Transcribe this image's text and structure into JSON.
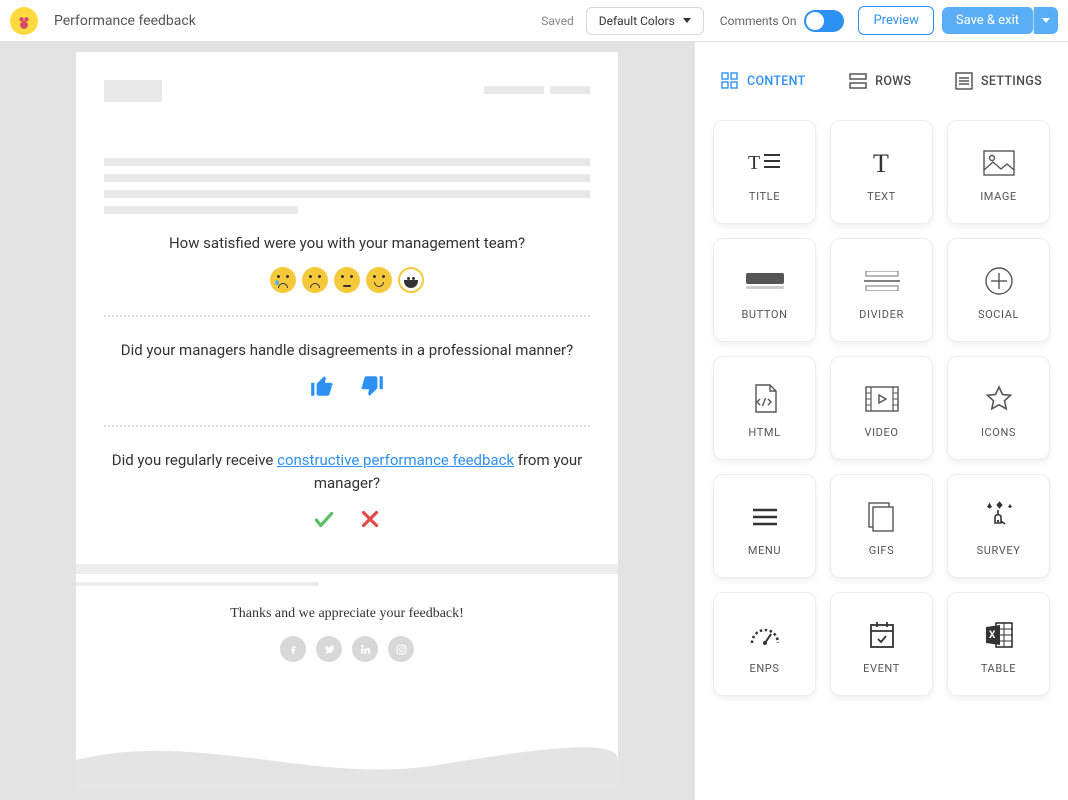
{
  "header": {
    "title": "Performance feedback",
    "saved_label": "Saved",
    "color_dropdown": "Default Colors",
    "comments_label": "Comments On",
    "preview_button": "Preview",
    "save_button": "Save & exit"
  },
  "preview": {
    "q1": "How satisfied were you with your management team?",
    "q2": "Did your managers handle disagreements in a professional manner?",
    "q3_prefix": "Did you regularly receive ",
    "q3_link": "constructive performance feedback",
    "q3_suffix": " from your manager?",
    "thanks": "Thanks and we appreciate your feedback!"
  },
  "panel": {
    "tabs": {
      "content": "CONTENT",
      "rows": "ROWS",
      "settings": "SETTINGS"
    },
    "tiles": [
      {
        "key": "title",
        "label": "TITLE"
      },
      {
        "key": "text",
        "label": "TEXT"
      },
      {
        "key": "image",
        "label": "IMAGE"
      },
      {
        "key": "button",
        "label": "BUTTON"
      },
      {
        "key": "divider",
        "label": "DIVIDER"
      },
      {
        "key": "social",
        "label": "SOCIAL"
      },
      {
        "key": "html",
        "label": "HTML"
      },
      {
        "key": "video",
        "label": "VIDEO"
      },
      {
        "key": "icons",
        "label": "ICONS"
      },
      {
        "key": "menu",
        "label": "MENU"
      },
      {
        "key": "gifs",
        "label": "GIFS"
      },
      {
        "key": "survey",
        "label": "SURVEY"
      },
      {
        "key": "enps",
        "label": "ENPS"
      },
      {
        "key": "event",
        "label": "EVENT"
      },
      {
        "key": "table",
        "label": "TABLE"
      }
    ]
  }
}
